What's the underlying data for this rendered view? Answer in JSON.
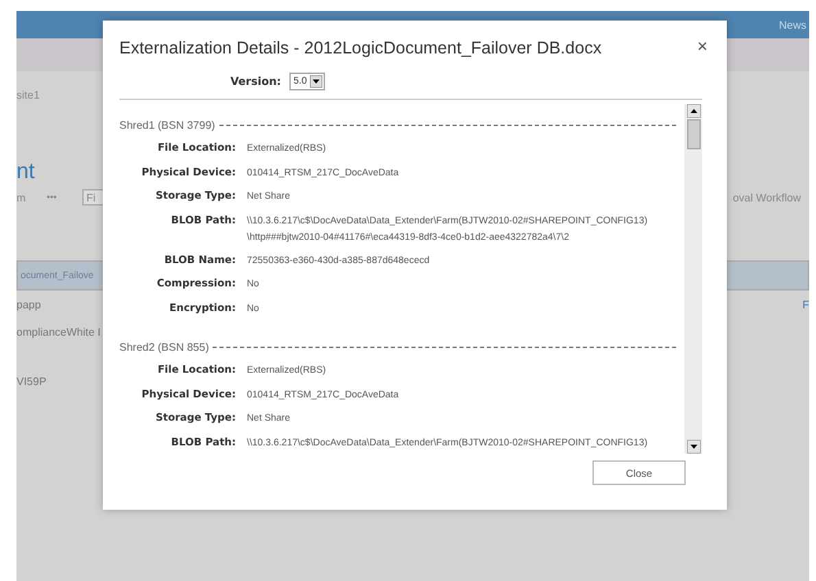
{
  "background": {
    "top_bar": {
      "link": "News"
    },
    "breadcrumb": "site1",
    "page_title": "nt",
    "toolbar": {
      "label": "m",
      "more": "•••",
      "filter_placeholder": "Fi",
      "column_heading": "oval Workflow"
    },
    "list_items": [
      {
        "label": "ocument_Failove",
        "selected": true
      },
      {
        "label": "papp",
        "selected": false,
        "trailing": "F"
      },
      {
        "label": "omplianceWhite I",
        "selected": false
      },
      {
        "label": "VI59P",
        "selected": false
      }
    ]
  },
  "dialog": {
    "title": "Externalization Details - 2012LogicDocument_Failover DB.docx",
    "close": "×",
    "version": {
      "label": "Version:",
      "value": "5.0"
    },
    "shreds": [
      {
        "heading": "Shred1 (BSN 3799)",
        "fields": [
          {
            "label": "File Location:",
            "lines": [
              "Externalized(RBS)"
            ]
          },
          {
            "label": "Physical Device:",
            "lines": [
              "010414_RTSM_217C_DocAveData"
            ]
          },
          {
            "label": "Storage Type:",
            "lines": [
              "Net Share"
            ]
          },
          {
            "label": "BLOB Path:",
            "lines": [
              "\\\\10.3.6.217\\c$\\DocAveData\\Data_Extender\\Farm(BJTW2010-02#SHAREPOINT_CONFIG13)",
              "\\http###bjtw2010-04#41176#\\eca44319-8df3-4ce0-b1d2-aee4322782a4\\7\\2"
            ]
          },
          {
            "label": "BLOB Name:",
            "lines": [
              "72550363-e360-430d-a385-887d648ececd"
            ]
          },
          {
            "label": "Compression:",
            "lines": [
              "No"
            ]
          },
          {
            "label": "Encryption:",
            "lines": [
              "No"
            ]
          }
        ]
      },
      {
        "heading": "Shred2 (BSN 855)",
        "fields": [
          {
            "label": "File Location:",
            "lines": [
              "Externalized(RBS)"
            ]
          },
          {
            "label": "Physical Device:",
            "lines": [
              "010414_RTSM_217C_DocAveData"
            ]
          },
          {
            "label": "Storage Type:",
            "lines": [
              "Net Share"
            ]
          },
          {
            "label": "BLOB Path:",
            "lines": [
              "\\\\10.3.6.217\\c$\\DocAveData\\Data_Extender\\Farm(BJTW2010-02#SHAREPOINT_CONFIG13)"
            ]
          }
        ]
      }
    ],
    "button": "Close"
  }
}
